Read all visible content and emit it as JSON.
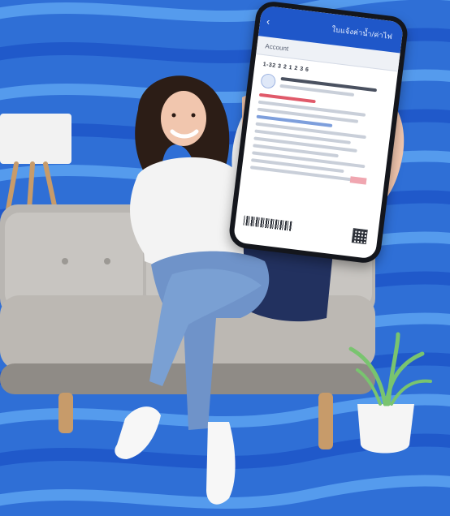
{
  "scene": {
    "description_tags": [
      "background-wave-stripes",
      "sofa",
      "floor-lamp",
      "plant-pot",
      "person",
      "hand",
      "smartphone"
    ],
    "colors": {
      "background_blue": "#2f6fd6",
      "stripe_light": "#5aa0f0",
      "stripe_dark": "#1f57c9",
      "sofa": "#b9b6b2",
      "sofa_shadow": "#8f8b86",
      "lamp_shade": "#f2f2f2",
      "lamp_legs": "#c79b6a",
      "jeans": "#6f93c9",
      "top": "#f3f3f3",
      "hair": "#2c1d16",
      "skin": "#f1c6ae",
      "plant_leaf": "#79c46f",
      "plant_pot": "#f5f5f5"
    }
  },
  "phone": {
    "app_title": "ใบแจ้งค่าน้ำ/ค่าไฟ",
    "tab_label": "Account",
    "document_id": "1-32 3 2 1 2 3 6"
  }
}
